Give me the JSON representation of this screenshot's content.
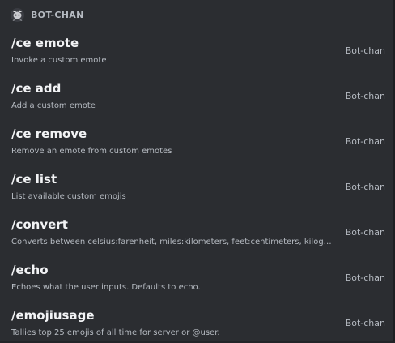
{
  "section": {
    "bot_name": "BOT-CHAN",
    "avatar_icon": "bot-avatar-icon"
  },
  "commands": [
    {
      "name": "/ce emote",
      "description": "Invoke a custom emote",
      "source": "Bot-chan"
    },
    {
      "name": "/ce add",
      "description": "Add a custom emote",
      "source": "Bot-chan"
    },
    {
      "name": "/ce remove",
      "description": "Remove an emote from custom emotes",
      "source": "Bot-chan"
    },
    {
      "name": "/ce list",
      "description": "List available custom emojis",
      "source": "Bot-chan"
    },
    {
      "name": "/convert",
      "description": "Converts between celsius:farenheit, miles:kilometers, feet:centimeters, kilograms:pounds",
      "source": "Bot-chan"
    },
    {
      "name": "/echo",
      "description": "Echoes what the user inputs. Defaults to echo.",
      "source": "Bot-chan"
    },
    {
      "name": "/emojiusage",
      "description": "Tallies top 25 emojis of all time for server or @user.",
      "source": "Bot-chan"
    }
  ],
  "colors": {
    "background": "#2b2d31",
    "command_name": "#f2f3f5",
    "secondary_text": "#b5bac1"
  }
}
